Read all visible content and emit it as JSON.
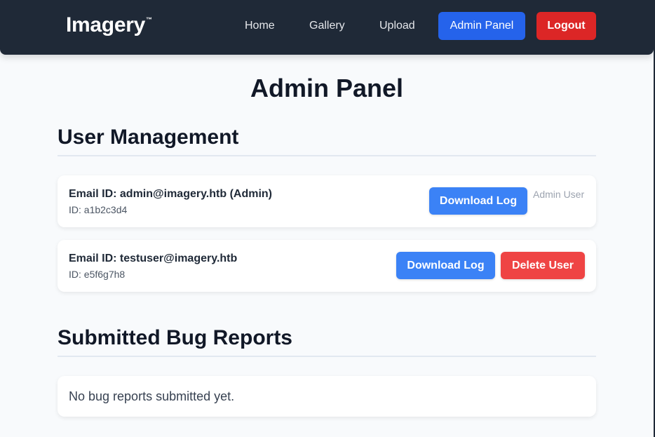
{
  "nav": {
    "brand": "Imagery",
    "brand_tm": "™",
    "links": [
      "Home",
      "Gallery",
      "Upload"
    ],
    "admin_panel": "Admin Panel",
    "logout": "Logout"
  },
  "page": {
    "title": "Admin Panel"
  },
  "users_section": {
    "title": "User Management",
    "users": [
      {
        "email": "Email ID: admin@imagery.htb (Admin)",
        "id": "ID: a1b2c3d4",
        "download_label": "Download Log",
        "note": "Admin User"
      },
      {
        "email": "Email ID: testuser@imagery.htb",
        "id": "ID: e5f6g7h8",
        "download_label": "Download Log",
        "delete_label": "Delete User"
      }
    ]
  },
  "bugs_section": {
    "title": "Submitted Bug Reports",
    "empty_text": "No bug reports submitted yet."
  },
  "colors": {
    "navbar": "#1f2937",
    "primary": "#3b82f6",
    "danger": "#ef4444",
    "nav_primary": "#2563eb",
    "nav_danger": "#dc2626"
  }
}
